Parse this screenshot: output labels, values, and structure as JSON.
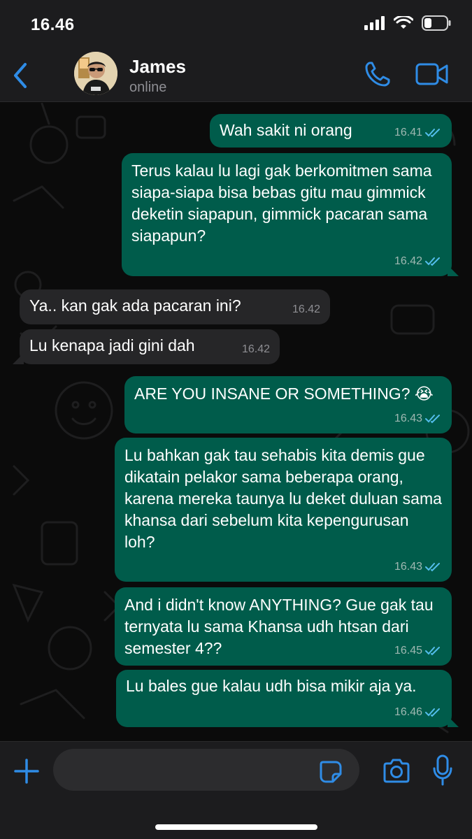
{
  "status_bar": {
    "time": "16.46"
  },
  "header": {
    "contact_name": "James",
    "contact_status": "online"
  },
  "messages": [
    {
      "direction": "out",
      "text": "Wah sakit ni orang",
      "time": "16.41"
    },
    {
      "direction": "out",
      "text": "Terus kalau lu lagi gak berkomitmen sama siapa-siapa bisa bebas gitu mau gimmick deketin siapapun, gimmick pacaran sama siapapun?",
      "time": "16.42"
    },
    {
      "direction": "in",
      "text": "Ya.. kan gak ada pacaran ini?",
      "time": "16.42"
    },
    {
      "direction": "in",
      "text": "Lu kenapa jadi gini dah",
      "time": "16.42"
    },
    {
      "direction": "out",
      "text": "ARE YOU INSANE OR SOMETHING? 😭",
      "time": "16.43"
    },
    {
      "direction": "out",
      "text": "Lu bahkan gak tau sehabis kita demis gue dikatain pelakor sama beberapa orang, karena mereka taunya lu deket duluan sama khansa dari sebelum kita kepengurusan loh?",
      "time": "16.43"
    },
    {
      "direction": "out",
      "text": "And i didn't know ANYTHING? Gue gak tau ternyata lu sama Khansa udh htsan dari semester 4??",
      "time": "16.45"
    },
    {
      "direction": "out",
      "text": "Lu bales gue kalau udh bisa mikir aja ya.",
      "time": "16.46"
    }
  ],
  "input": {
    "value": "",
    "placeholder": ""
  },
  "icons": {
    "back": "chevron-left-icon",
    "call": "phone-icon",
    "video": "video-camera-icon",
    "plus": "plus-icon",
    "sticker": "sticker-icon",
    "camera": "camera-icon",
    "mic": "microphone-icon",
    "read_receipt": "double-check-icon"
  },
  "colors": {
    "accent": "#2f8ce6",
    "outgoing_bubble": "#005c4b",
    "incoming_bubble": "#262628",
    "read_receipt": "#53bdeb"
  }
}
